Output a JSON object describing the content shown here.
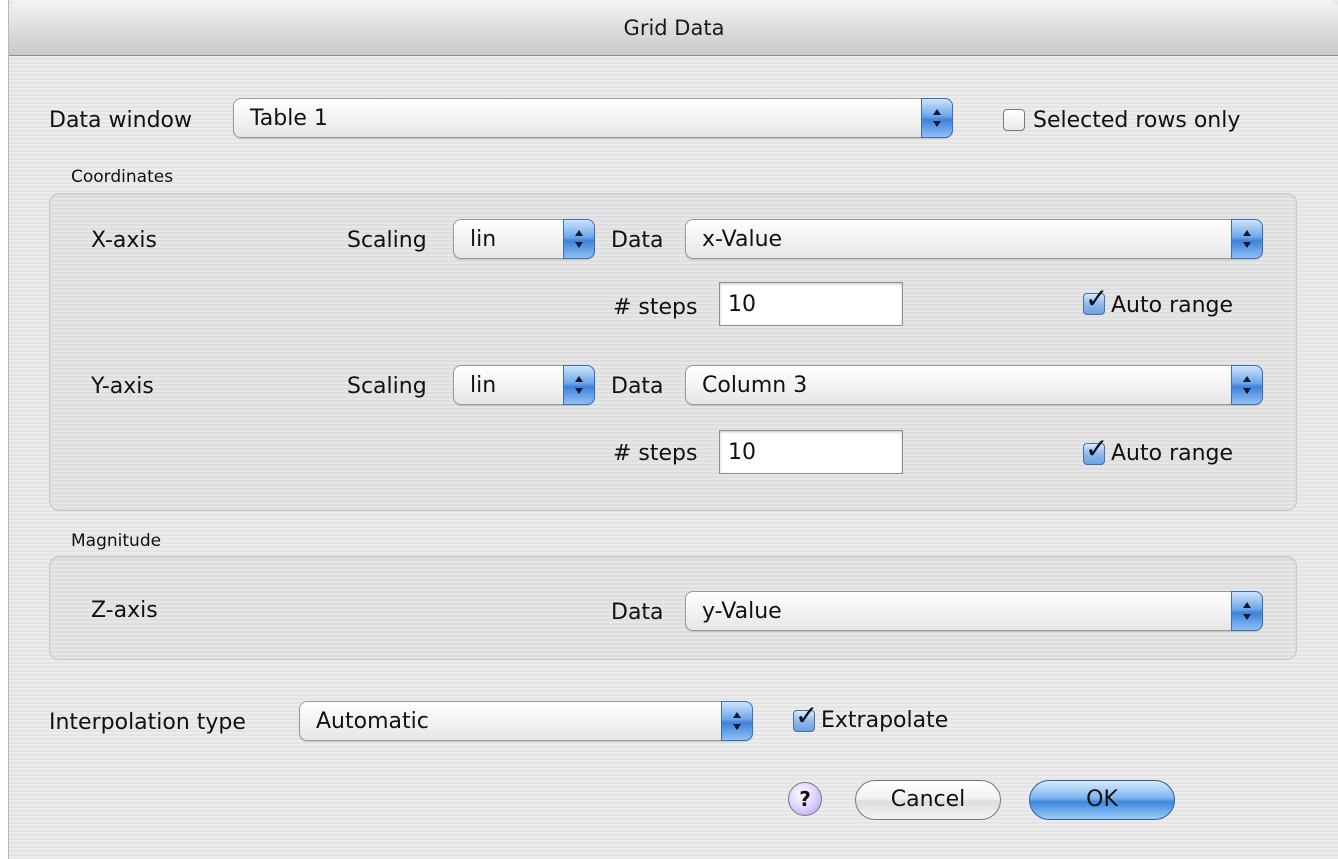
{
  "window": {
    "title": "Grid Data"
  },
  "data_window": {
    "label": "Data window",
    "value": "Table 1",
    "selected_rows_only": {
      "label": "Selected rows only",
      "checked": false
    }
  },
  "coordinates": {
    "section_label": "Coordinates",
    "x_axis": {
      "label": "X-axis",
      "scaling_label": "Scaling",
      "scaling_value": "lin",
      "data_label": "Data",
      "data_value": "x-Value",
      "steps_label": "# steps",
      "steps_value": "10",
      "auto_range": {
        "label": "Auto range",
        "checked": true
      }
    },
    "y_axis": {
      "label": "Y-axis",
      "scaling_label": "Scaling",
      "scaling_value": "lin",
      "data_label": "Data",
      "data_value": "Column 3",
      "steps_label": "# steps",
      "steps_value": "10",
      "auto_range": {
        "label": "Auto range",
        "checked": true
      }
    }
  },
  "magnitude": {
    "section_label": "Magnitude",
    "z_axis": {
      "label": "Z-axis",
      "data_label": "Data",
      "data_value": "y-Value"
    }
  },
  "interpolation": {
    "label": "Interpolation type",
    "value": "Automatic",
    "extrapolate": {
      "label": "Extrapolate",
      "checked": true
    }
  },
  "buttons": {
    "help": "?",
    "cancel": "Cancel",
    "ok": "OK"
  }
}
